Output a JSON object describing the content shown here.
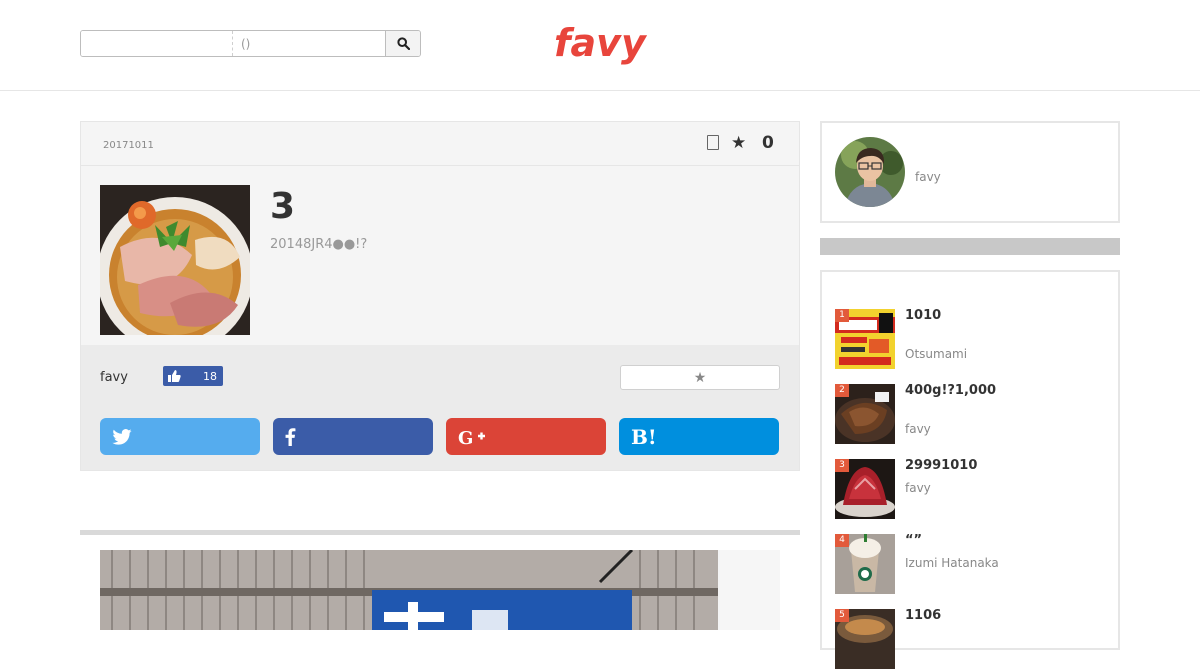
{
  "header": {
    "search": {
      "keyword_value": "",
      "area_placeholder": "()"
    },
    "logo_text": "favy"
  },
  "article": {
    "date": "20171011",
    "fav_count": "0",
    "title": "3",
    "subtitle": "20148JR4●●!?",
    "author": "favy",
    "like_count": "18",
    "share_buttons": [
      {
        "name": "twitter",
        "color": "#55acee"
      },
      {
        "name": "facebook",
        "color": "#3b5ca8"
      },
      {
        "name": "google-plus",
        "color": "#db4437"
      },
      {
        "name": "hatena-bookmark",
        "color": "#008fde",
        "label": "B!"
      }
    ]
  },
  "sidebar": {
    "profile_name": "favy",
    "ranking": [
      {
        "rank": "1",
        "title": "1010",
        "author": "Otsumami"
      },
      {
        "rank": "2",
        "title": "400g!?1,000",
        "author": "favy"
      },
      {
        "rank": "3",
        "title": "29991010",
        "author": "favy"
      },
      {
        "rank": "4",
        "title": "“”",
        "author": "Izumi Hatanaka"
      },
      {
        "rank": "5",
        "title": "1106",
        "author": ""
      }
    ]
  },
  "colors": {
    "brand": "#e8453c",
    "twitter": "#55acee",
    "facebook": "#3b5ca8",
    "google_plus": "#db4437",
    "hatena": "#008fde",
    "rank_badge": "#e25a3b"
  }
}
